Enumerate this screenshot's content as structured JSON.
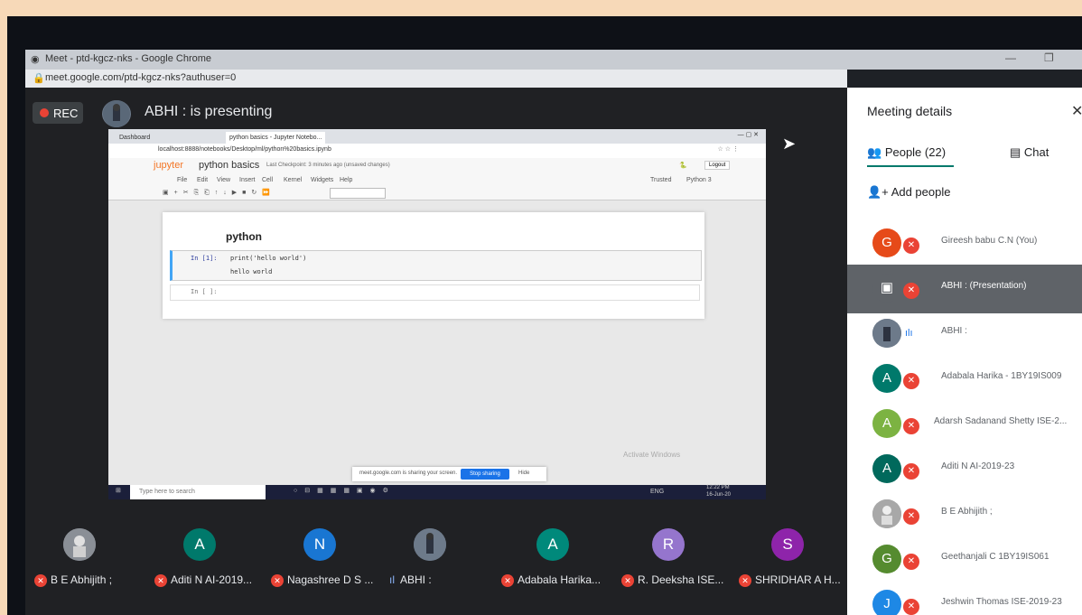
{
  "window": {
    "title": "Meet - ptd-kgcz-nks - Google Chrome",
    "url": "meet.google.com/ptd-kgcz-nks?authuser=0",
    "minimize": "—",
    "restore": "❐"
  },
  "meet": {
    "rec_label": "REC",
    "presenting_text": "ABHI : is presenting"
  },
  "shared_screen": {
    "tab1": "Dashboard",
    "tab2": "python basics - Jupyter Notebo...",
    "address": "localhost:8888/notebooks/Desktop/ml/python%20basics.ipynb",
    "jupyter_logo": "jupyter",
    "notebook_title": "python basics",
    "checkpoint": "Last Checkpoint: 3 minutes ago (unsaved changes)",
    "logout": "Logout",
    "menu": [
      "File",
      "Edit",
      "View",
      "Insert",
      "Cell",
      "Kernel",
      "Widgets",
      "Help"
    ],
    "kernel_status": "Trusted",
    "kernel_name": "Python 3",
    "heading": "python",
    "cell1_prompt": "In [1]:",
    "cell1_code": "print('hello world')",
    "cell1_output": "hello world",
    "cell2_prompt": "In [ ]:",
    "share_text": "meet.google.com is sharing your screen.",
    "stop_sharing": "Stop sharing",
    "hide": "Hide",
    "activate_windows": "Activate Windows",
    "taskbar_search": "Type here to search",
    "taskbar_time": "12:22 PM",
    "taskbar_date": "16-Jun-20",
    "taskbar_lang": "ENG"
  },
  "participants_strip": [
    {
      "initial": "",
      "name": "B E Abhijith ;",
      "color": "#7a7f86",
      "muted": true
    },
    {
      "initial": "A",
      "name": "Aditi N AI-2019...",
      "color": "#00796b",
      "muted": true
    },
    {
      "initial": "N",
      "name": "Nagashree D S ...",
      "color": "#1976d2",
      "muted": true
    },
    {
      "initial": "",
      "name": "ABHI :",
      "color": "#6d7a8a",
      "muted": false
    },
    {
      "initial": "A",
      "name": "Adabala Harika...",
      "color": "#00897b",
      "muted": true
    },
    {
      "initial": "R",
      "name": "R. Deeksha ISE...",
      "color": "#9575cd",
      "muted": true
    },
    {
      "initial": "S",
      "name": "SHRIDHAR A H...",
      "color": "#8e24aa",
      "muted": true
    }
  ],
  "panel": {
    "title": "Meeting details",
    "close": "✕",
    "people_tab": "People (22)",
    "chat_tab": "Chat",
    "add_people": "Add people",
    "people": [
      {
        "initial": "G",
        "name": "Gireesh babu C.N (You)",
        "color": "#e64a19"
      },
      {
        "initial": "▣",
        "name": "ABHI : (Presentation)",
        "color": "#5f6368"
      },
      {
        "initial": "",
        "name": "ABHI :",
        "color": "#6d7a8a"
      },
      {
        "initial": "A",
        "name": "Adabala Harika - 1BY19IS009",
        "color": "#00796b"
      },
      {
        "initial": "A",
        "name": "Adarsh Sadanand Shetty ISE-2...",
        "color": "#7cb342"
      },
      {
        "initial": "A",
        "name": "Aditi N AI-2019-23",
        "color": "#00695c"
      },
      {
        "initial": "",
        "name": "B E Abhijith ;",
        "color": "#9e9e9e"
      },
      {
        "initial": "G",
        "name": "Geethanjali C 1BY19IS061",
        "color": "#558b2f"
      },
      {
        "initial": "J",
        "name": "Jeshwin Thomas ISE-2019-23",
        "color": "#1e88e5"
      }
    ]
  }
}
